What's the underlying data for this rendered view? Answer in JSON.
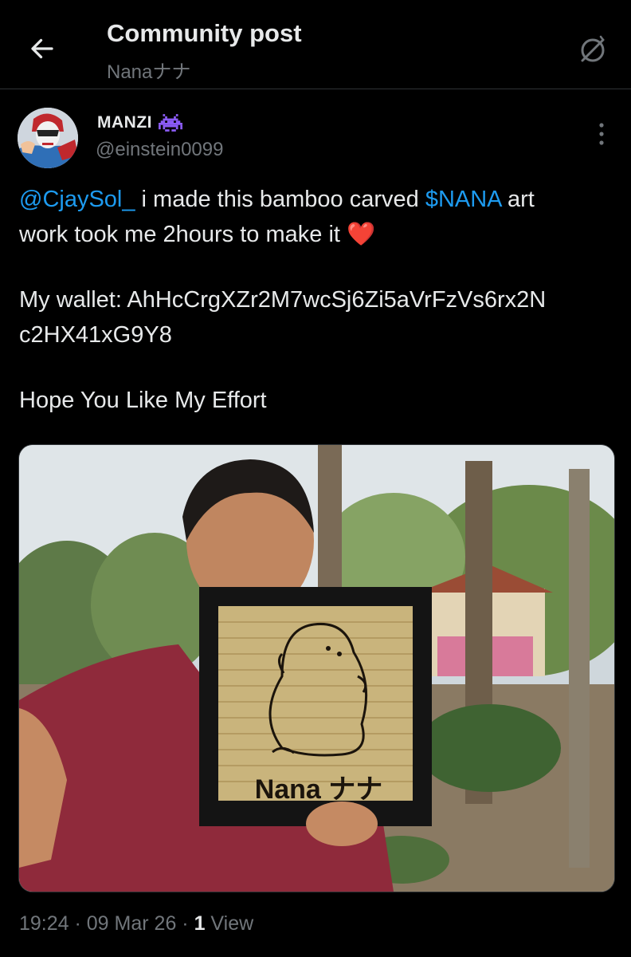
{
  "header": {
    "title": "Community post",
    "community_name": "Nanaナナ"
  },
  "author": {
    "display_name": "MANZI",
    "badge_icon": "space-invader-icon",
    "handle": "@einstein0099"
  },
  "post": {
    "mention": "@CjaySol_",
    "text_1": " i made this bamboo carved ",
    "cashtag": "$NANA",
    "text_2": " art",
    "line_2": "work took me 2hours to make it",
    "emoji": "❤️",
    "wallet_line_1": "My wallet: AhHcCrgXZr2M7wcSj6Zi5aVrFzVs6rx2N",
    "wallet_line_2": "c2HX41xG9Y8",
    "closing": "Hope You Like My Effort"
  },
  "media": {
    "frame_text": "Nana ナナ"
  },
  "meta": {
    "time": "19:24",
    "separator": " · ",
    "date": "09 Mar 26",
    "views_count": "1",
    "views_label": " View"
  },
  "colors": {
    "background": "#000000",
    "text": "#e7e9ea",
    "secondary": "#71767b",
    "link": "#1d9bf0",
    "divider": "#2f3336"
  }
}
